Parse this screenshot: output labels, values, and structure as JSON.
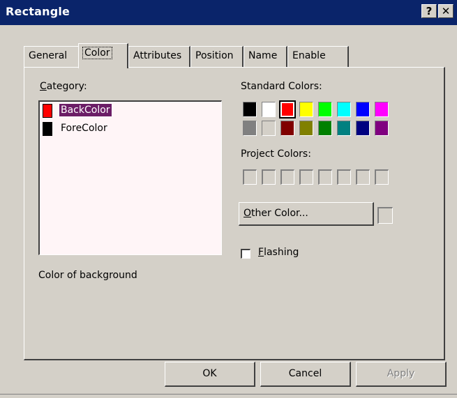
{
  "window": {
    "title": "Rectangle",
    "help_label": "?",
    "close_label": "✕"
  },
  "tabs": [
    {
      "label": "General",
      "active": false
    },
    {
      "label": "Color",
      "active": true
    },
    {
      "label": "Attributes",
      "active": false
    },
    {
      "label": "Position",
      "active": false
    },
    {
      "label": "Name",
      "active": false
    },
    {
      "label": "Enable",
      "active": false
    }
  ],
  "category": {
    "label_first": "C",
    "label_rest": "ategory:",
    "items": [
      {
        "label": "BackColor",
        "color": "#ff0000",
        "selected": true
      },
      {
        "label": "ForeColor",
        "color": "#000000",
        "selected": false
      }
    ],
    "description": "Color of background"
  },
  "standard_colors": {
    "label": "Standard Colors:",
    "row1": [
      "#000000",
      "#ffffff",
      "#ff0000",
      "#ffff00",
      "#00ff00",
      "#00ffff",
      "#0000ff",
      "#ff00ff"
    ],
    "row2": [
      "#808080",
      "#d4d0c8",
      "#800000",
      "#808000",
      "#008000",
      "#008080",
      "#000080",
      "#800080"
    ],
    "selected_color": "#ff0000"
  },
  "project_colors": {
    "label": "Project Colors:"
  },
  "other_color": {
    "label_first": "O",
    "label_rest": "ther Color..."
  },
  "flashing": {
    "label_first": "F",
    "label_rest": "lashing",
    "checked": false
  },
  "buttons": {
    "ok": "OK",
    "cancel": "Cancel",
    "apply": "Apply"
  }
}
